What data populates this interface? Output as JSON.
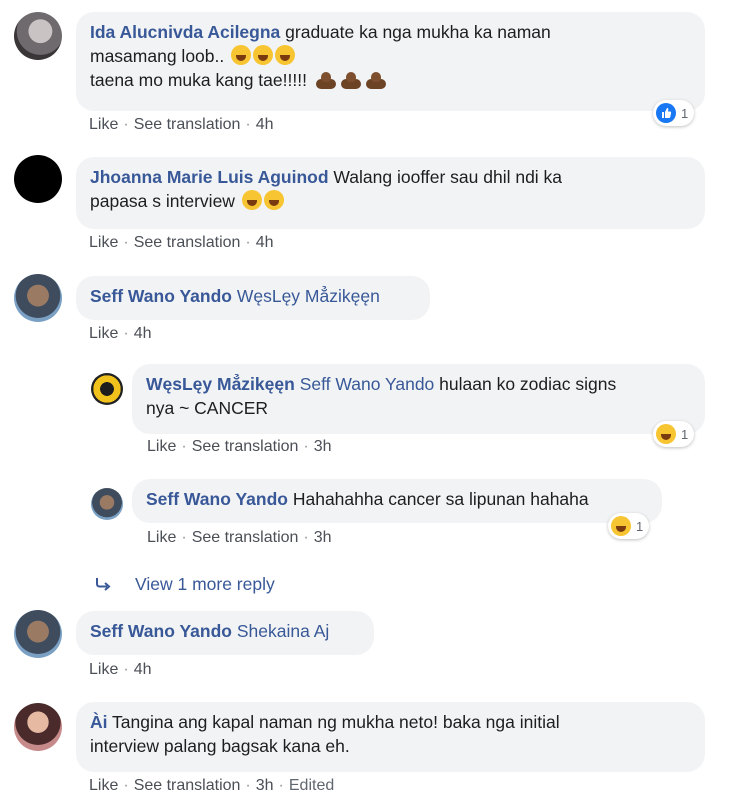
{
  "labels": {
    "like": "Like",
    "see_translation": "See translation",
    "dot": "·"
  },
  "comments": [
    {
      "author": "Ida Alucnivda Acilegna",
      "text_line1": "graduate ka nga mukha ka naman",
      "text_line2": "masamang loob..",
      "text_line3": "taena mo muka kang tae!!!!!",
      "time": "4h",
      "reaction_count": "1",
      "reaction_type": "like-icon"
    },
    {
      "author": "Jhoanna Marie Luis Aguinod",
      "text_line1": "Walang iooffer sau dhil ndi ka",
      "text_line2": "papasa s interview",
      "time": "4h"
    },
    {
      "author": "Seff Wano Yando",
      "mention": "WęsLęy Mẳzikęęn",
      "time": "4h"
    },
    {
      "author": "WęsLęy Mẳzikęęn",
      "mention": "Seff Wano Yando",
      "text_line1": "hulaan ko zodiac signs",
      "text_line2": "nya ~ CANCER",
      "time": "3h",
      "reaction_count": "1",
      "reaction_type": "haha-icon"
    },
    {
      "author": "Seff Wano Yando",
      "text_line1": "Hahahahha cancer sa lipunan hahaha",
      "time": "3h",
      "reaction_count": "1",
      "reaction_type": "haha-icon"
    },
    {
      "author": "Seff Wano Yando",
      "mention": "Shekaina Aj",
      "time": "4h"
    },
    {
      "author": "Ài",
      "text_line1": "Tangina ang kapal naman ng mukha neto! baka nga initial",
      "text_line2": "interview palang bagsak kana eh.",
      "time": "3h",
      "edited": "Edited"
    }
  ],
  "view_more_reply": "View 1 more reply",
  "colors": {
    "link": "#385898",
    "bubble": "#f2f3f5",
    "like_blue": "#1877f2",
    "haha_yellow": "#f7c531"
  }
}
